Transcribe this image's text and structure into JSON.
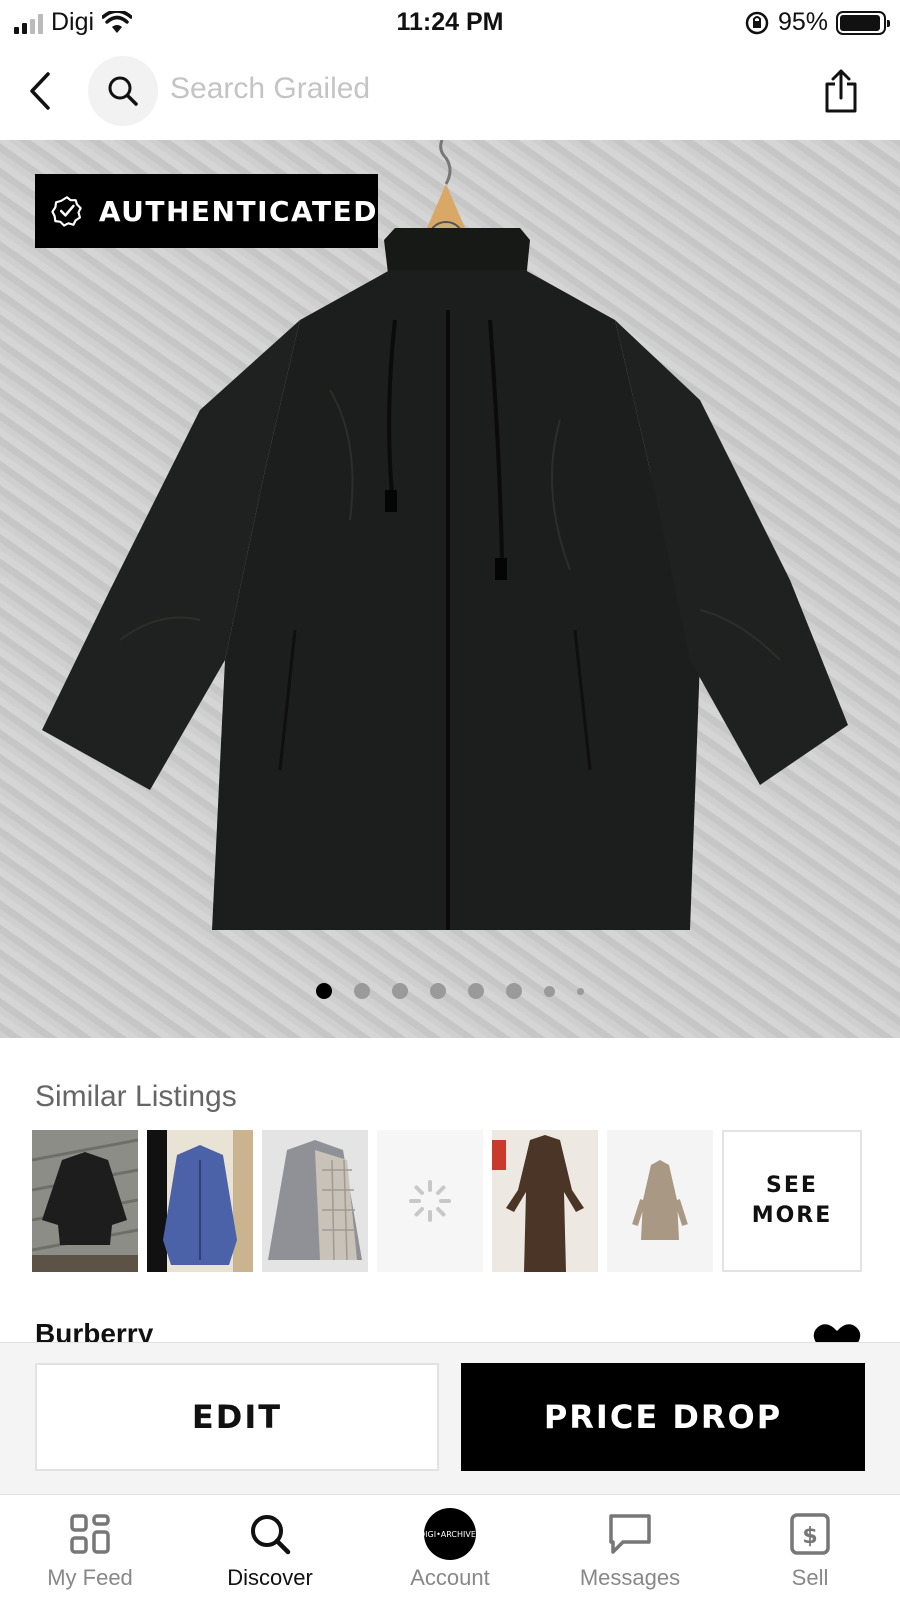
{
  "status_bar": {
    "carrier": "Digi",
    "time": "11:24 PM",
    "battery": "95%"
  },
  "nav": {
    "search_placeholder": "Search Grailed"
  },
  "hero": {
    "badge": "AUTHENTICATED",
    "image_count": 8,
    "active_image": 1
  },
  "similar": {
    "title": "Similar Listings",
    "see_more": "SEE MORE"
  },
  "listing": {
    "brand": "Burberry"
  },
  "actions": {
    "edit": "EDIT",
    "price_drop": "PRICE DROP"
  },
  "tabs": [
    {
      "label": "My Feed",
      "icon": "grid-icon"
    },
    {
      "label": "Discover",
      "icon": "search-icon"
    },
    {
      "label": "Account",
      "icon": "avatar"
    },
    {
      "label": "Messages",
      "icon": "chat-icon"
    },
    {
      "label": "Sell",
      "icon": "dollar-tag-icon"
    }
  ],
  "avatar_text": "DIGI•ARCHIVES",
  "colors": {
    "accent": "#000000",
    "placeholder": "#c4c4c4",
    "inactive_tab": "#888888"
  }
}
